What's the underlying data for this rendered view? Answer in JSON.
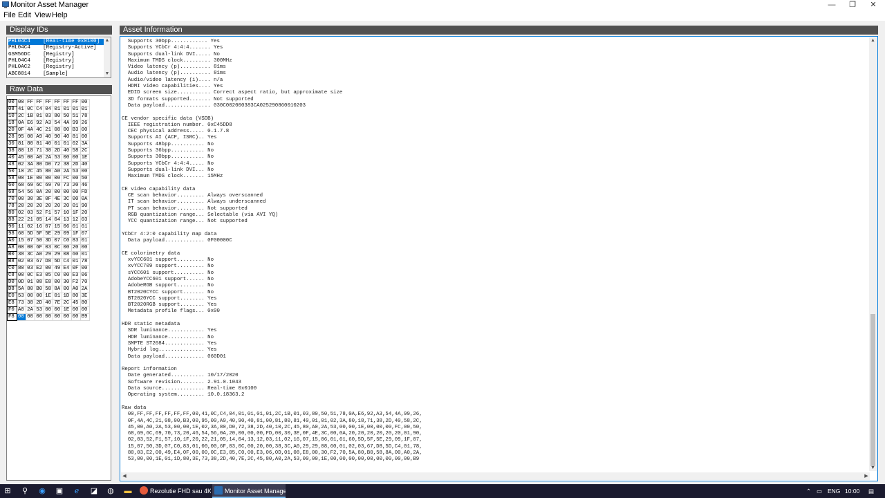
{
  "window": {
    "title": "Monitor Asset Manager",
    "minimize": "—",
    "restore": "❐",
    "close": "✕"
  },
  "menu": [
    "File",
    "Edit",
    "View",
    "Help"
  ],
  "panels": {
    "display_ids": "Display IDs",
    "raw_data": "Raw Data",
    "asset_info": "Asset Information"
  },
  "display_ids": [
    "PHL04C4    [Real-time 0x0100]",
    "PHL04C4    [Registry-Active]",
    "GSM56DC    [Registry]",
    "PHL04C4    [Registry]",
    "PHL0AC2    [Registry]",
    "ABC8014    [Sample]"
  ],
  "hex": [
    [
      "00",
      "00",
      "FF",
      "FF",
      "FF",
      "FF",
      "FF",
      "FF",
      "00"
    ],
    [
      "08",
      "41",
      "0C",
      "C4",
      "04",
      "01",
      "01",
      "01",
      "01"
    ],
    [
      "10",
      "2C",
      "1B",
      "01",
      "03",
      "80",
      "50",
      "51",
      "78"
    ],
    [
      "18",
      "0A",
      "E6",
      "92",
      "A3",
      "54",
      "4A",
      "99",
      "26"
    ],
    [
      "20",
      "0F",
      "4A",
      "4C",
      "21",
      "08",
      "00",
      "B3",
      "00"
    ],
    [
      "28",
      "95",
      "00",
      "A9",
      "40",
      "90",
      "40",
      "81",
      "00"
    ],
    [
      "30",
      "81",
      "80",
      "81",
      "40",
      "01",
      "01",
      "02",
      "3A"
    ],
    [
      "38",
      "80",
      "18",
      "71",
      "38",
      "2D",
      "40",
      "58",
      "2C"
    ],
    [
      "40",
      "45",
      "00",
      "A0",
      "2A",
      "53",
      "00",
      "00",
      "1E"
    ],
    [
      "48",
      "02",
      "3A",
      "80",
      "D0",
      "72",
      "38",
      "2D",
      "40"
    ],
    [
      "50",
      "10",
      "2C",
      "45",
      "80",
      "A0",
      "2A",
      "53",
      "00"
    ],
    [
      "58",
      "00",
      "1E",
      "00",
      "00",
      "00",
      "FC",
      "00",
      "50"
    ],
    [
      "60",
      "68",
      "69",
      "6C",
      "69",
      "70",
      "73",
      "20",
      "46"
    ],
    [
      "68",
      "54",
      "56",
      "0A",
      "20",
      "00",
      "00",
      "00",
      "FD"
    ],
    [
      "70",
      "00",
      "30",
      "3E",
      "0F",
      "4E",
      "3C",
      "00",
      "0A"
    ],
    [
      "78",
      "20",
      "20",
      "20",
      "20",
      "20",
      "20",
      "01",
      "90"
    ],
    [
      "80",
      "02",
      "03",
      "52",
      "F1",
      "57",
      "10",
      "1F",
      "20"
    ],
    [
      "88",
      "22",
      "21",
      "05",
      "14",
      "04",
      "13",
      "12",
      "03"
    ],
    [
      "90",
      "11",
      "02",
      "16",
      "07",
      "15",
      "06",
      "01",
      "61"
    ],
    [
      "98",
      "60",
      "5D",
      "5F",
      "5E",
      "29",
      "09",
      "1F",
      "07"
    ],
    [
      "A0",
      "15",
      "07",
      "50",
      "3D",
      "07",
      "C0",
      "83",
      "01"
    ],
    [
      "A8",
      "00",
      "00",
      "6F",
      "03",
      "0C",
      "00",
      "20",
      "00"
    ],
    [
      "B0",
      "38",
      "3C",
      "A0",
      "29",
      "29",
      "08",
      "60",
      "01"
    ],
    [
      "B8",
      "02",
      "03",
      "67",
      "D8",
      "5D",
      "C4",
      "01",
      "78"
    ],
    [
      "C0",
      "80",
      "03",
      "E2",
      "00",
      "49",
      "E4",
      "0F",
      "00"
    ],
    [
      "C8",
      "00",
      "0C",
      "E3",
      "05",
      "C0",
      "00",
      "E3",
      "06"
    ],
    [
      "D0",
      "0D",
      "01",
      "08",
      "E8",
      "00",
      "30",
      "F2",
      "70"
    ],
    [
      "D8",
      "5A",
      "80",
      "B0",
      "58",
      "8A",
      "00",
      "A0",
      "2A"
    ],
    [
      "E0",
      "53",
      "00",
      "00",
      "1E",
      "01",
      "1D",
      "80",
      "3E"
    ],
    [
      "E8",
      "73",
      "38",
      "2D",
      "40",
      "7E",
      "2C",
      "45",
      "80"
    ],
    [
      "F0",
      "A0",
      "2A",
      "53",
      "00",
      "00",
      "1E",
      "00",
      "00"
    ],
    [
      "F8",
      "00",
      "00",
      "00",
      "00",
      "00",
      "00",
      "00",
      "B9"
    ]
  ],
  "asset_text": "  Supports 30bpp............ Yes\n  Supports YCbCr 4:4:4....... Yes\n  Supports dual-link DVI..... No\n  Maximum TMDS clock......... 300MHz\n  Video latency (p).......... 81ms\n  Audio latency (p).......... 81ms\n  Audio/video latency (i).... n/a\n  HDMI video capabilities.... Yes\n  EDID screen size........... Correct aspect ratio, but approximate size\n  3D formats supported....... Not supported\n  Data payload............... 030C002000383CA025290860010203\n\nCE vendor specific data (VSDB)\n  IEEE registration number. 0xC45DD8\n  CEC physical address..... 0.1.7.8\n  Supports AI (ACP, ISRC).. Yes\n  Supports 48bpp........... No\n  Supports 36bpp........... No\n  Supports 30bpp........... No\n  Supports YCbCr 4:4:4..... No\n  Supports dual-link DVI... No\n  Maximum TMDS clock....... 15MHz\n\nCE video capability data\n  CE scan behavior......... Always overscanned\n  IT scan behavior......... Always underscanned\n  PT scan behavior......... Not supported\n  RGB quantization range... Selectable (via AVI YQ)\n  YCC quantization range... Not supported\n\nYCbCr 4:2:0 capability map data\n  Data payload............. 0F00000C\n\nCE colorimetry data\n  xvYCC601 support......... No\n  xvYCC709 support......... No\n  sYCC601 support.......... No\n  AdobeYCC601 support...... No\n  AdobeRGB support......... No\n  BT2020CYCC support....... No\n  BT2020YCC support........ Yes\n  BT2020RGB support........ Yes\n  Metadata profile flags... 0x00\n\nHDR static metadata\n  SDR luminance............ Yes\n  HDR luminance............ No\n  SMPTE ST2084............. Yes\n  Hybrid log............... Yes\n  Data payload............. 060D01\n\nReport information\n  Date generated........... 10/17/2020\n  Software revision........ 2.91.0.1043\n  Data source.............. Real-time 0x0100\n  Operating system......... 10.0.18363.2\n\nRaw data\n  00,FF,FF,FF,FF,FF,FF,00,41,0C,C4,04,01,01,01,01,2C,1B,01,03,80,50,51,78,0A,E6,92,A3,54,4A,99,26,\n  0F,4A,4C,21,08,00,B3,00,95,00,A9,40,90,40,81,00,81,80,81,40,01,01,02,3A,80,18,71,38,2D,40,58,2C,\n  45,00,A0,2A,53,00,00,1E,02,3A,80,D0,72,38,2D,40,10,2C,45,80,A0,2A,53,00,00,1E,00,00,00,FC,00,50,\n  68,69,6C,69,70,73,20,46,54,56,0A,20,00,00,00,FD,00,30,3E,0F,4E,3C,00,0A,20,20,20,20,20,20,01,90,\n  02,03,52,F1,57,10,1F,20,22,21,05,14,04,13,12,03,11,02,16,07,15,06,01,61,60,5D,5F,5E,29,09,1F,07,\n  15,07,50,3D,07,C0,83,01,00,00,6F,03,0C,00,20,00,38,3C,A0,29,29,08,60,01,02,03,67,D8,5D,C4,01,78,\n  80,03,E2,00,49,E4,0F,00,00,0C,E3,05,C0,00,E3,06,0D,01,08,E8,00,30,F2,70,5A,80,B0,58,8A,00,A0,2A,\n  53,00,00,1E,01,1D,80,3E,73,38,2D,40,7E,2C,45,80,A0,2A,53,00,00,1E,00,00,00,00,00,00,00,00,00,B9",
  "taskbar": {
    "task1": "Rezolutie FHD sau 4K ...",
    "task2": "Monitor Asset Manager",
    "lang": "ENG",
    "time": "10:00"
  },
  "colors": {
    "accent": "#0078d7",
    "panel_header": "#515151",
    "taskbar": "#1b1b2f"
  }
}
